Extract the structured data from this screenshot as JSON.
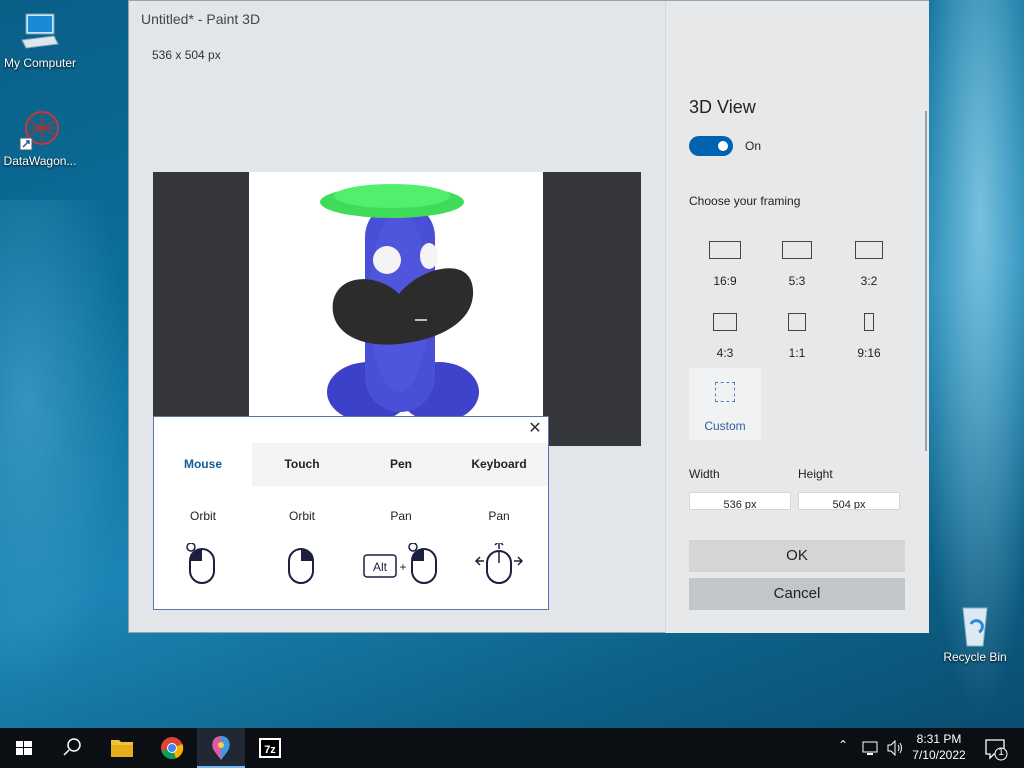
{
  "desktop": {
    "icons": [
      {
        "label": "My Computer",
        "icon": "computer-icon"
      },
      {
        "label": "DataWagon...",
        "icon": "molecule-shortcut-icon"
      },
      {
        "label": "Recycle Bin",
        "icon": "recycle-bin-icon"
      }
    ]
  },
  "window": {
    "title": "Untitled* - Paint 3D",
    "controls": {
      "minimize": "—",
      "maximize": "☐",
      "close": "✕"
    },
    "canvas_size_label": "536 x 504 px"
  },
  "panel": {
    "title": "3D View",
    "toggle": {
      "state": "On",
      "on": true
    },
    "framing_heading": "Choose your framing",
    "framing_options": [
      {
        "label": "16:9"
      },
      {
        "label": "5:3"
      },
      {
        "label": "3:2"
      },
      {
        "label": "4:3"
      },
      {
        "label": "1:1"
      },
      {
        "label": "9:16"
      },
      {
        "label": "Custom"
      }
    ],
    "width_label": "Width",
    "height_label": "Height",
    "width_value": "536 px",
    "height_value": "504 px",
    "ok_label": "OK",
    "cancel_label": "Cancel"
  },
  "help_popup": {
    "close": "✕",
    "tabs": [
      {
        "label": "Mouse",
        "active": true
      },
      {
        "label": "Touch",
        "active": false
      },
      {
        "label": "Pen",
        "active": false
      },
      {
        "label": "Keyboard",
        "active": false
      }
    ],
    "actions": [
      {
        "label": "Orbit",
        "icon": "mouse-left-click-icon"
      },
      {
        "label": "Orbit",
        "icon": "mouse-right-click-icon"
      },
      {
        "label": "Pan",
        "icon": "alt-plus-mouse-click-icon",
        "key": "Alt",
        "plus": "+"
      },
      {
        "label": "Pan",
        "icon": "mouse-drag-arrows-icon"
      }
    ]
  },
  "taskbar": {
    "time": "8:31 PM",
    "date": "7/10/2022",
    "notification_count": "1",
    "apps": [
      "start-icon",
      "search-icon",
      "file-explorer-icon",
      "chrome-icon",
      "paint-3d-icon",
      "7zip-icon"
    ]
  },
  "colors": {
    "accent": "#0063b1",
    "taskbar": "#0b0f14",
    "hat": "#3fdc5a",
    "body": "#4a4fd8",
    "mustache": "#2c2c2c"
  }
}
